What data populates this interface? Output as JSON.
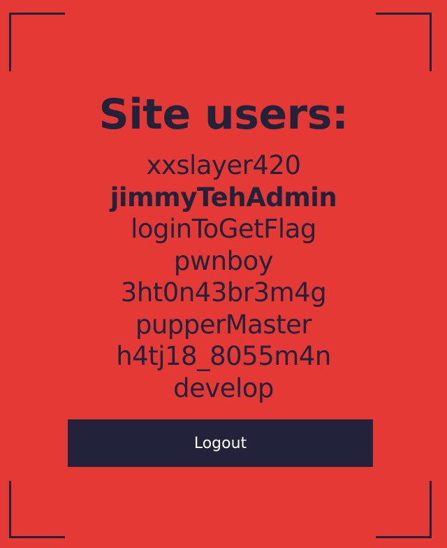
{
  "heading": "Site users:",
  "users": [
    {
      "name": "xxslayer420",
      "highlight": false
    },
    {
      "name": "jimmyTehAdmin",
      "highlight": true
    },
    {
      "name": "loginToGetFlag",
      "highlight": false
    },
    {
      "name": "pwnboy",
      "highlight": false
    },
    {
      "name": "3ht0n43br3m4g",
      "highlight": false
    },
    {
      "name": "pupperMaster",
      "highlight": false
    },
    {
      "name": "h4tj18_8055m4n",
      "highlight": false
    },
    {
      "name": "develop",
      "highlight": false
    }
  ],
  "logout_label": "Logout",
  "colors": {
    "background": "#e53935",
    "text": "#22223a",
    "button_background": "#22223a",
    "button_text": "#ffffff"
  }
}
